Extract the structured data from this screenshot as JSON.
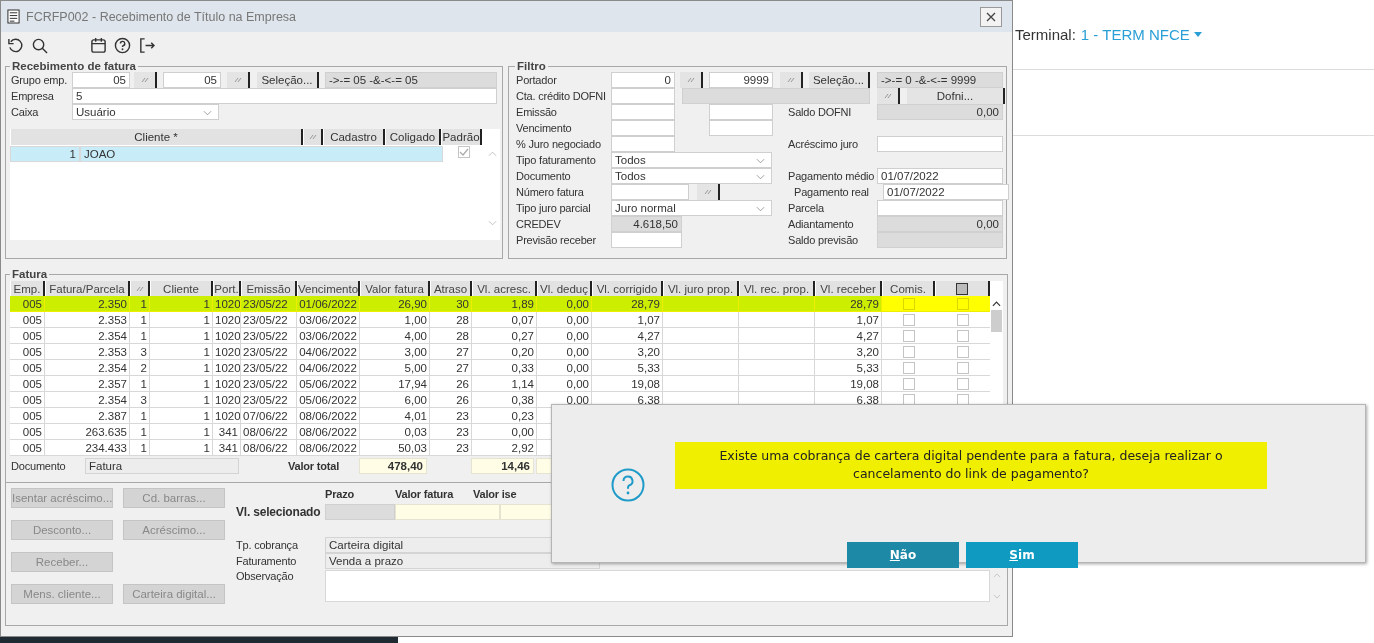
{
  "window": {
    "title": "FCRFP002 - Recebimento de Título na Empresa"
  },
  "recebimento": {
    "title": "Recebimento de fatura",
    "grupo_emp": {
      "label": "Grupo emp.",
      "from": "05",
      "to": "05",
      "selection_button": "Seleção...",
      "range": "->-= 05 -&-<-= 05"
    },
    "empresa": {
      "label": "Empresa",
      "value": "5"
    },
    "caixa": {
      "label": "Caixa",
      "value": "Usuário"
    },
    "clientes": {
      "columns": [
        "Cliente *",
        "Cadastro",
        "Coligado",
        "Padrão"
      ],
      "rows": [
        {
          "code": "1",
          "name": "JOAO",
          "padrao": true,
          "selected": true
        }
      ]
    }
  },
  "filtro": {
    "title": "Filtro",
    "portador": {
      "label": "Portador",
      "from": "0",
      "to": "9999",
      "selection_button": "Seleção...",
      "range": "->-= 0 -&-<-= 9999"
    },
    "cta_credito": {
      "label": "Cta. crédito DOFNI",
      "button": "Dofni..."
    },
    "emissao": {
      "label": "Emissão"
    },
    "vencimento": {
      "label": "Vencimento"
    },
    "juro_negociado": {
      "label": "% Juro negociado"
    },
    "tipo_faturamento": {
      "label": "Tipo faturamento",
      "value": "Todos"
    },
    "documento": {
      "label": "Documento",
      "value": "Todos"
    },
    "numero_fatura": {
      "label": "Número fatura"
    },
    "tipo_juro_parcial": {
      "label": "Tipo juro parcial",
      "value": "Juro normal"
    },
    "credev": {
      "label": "CREDEV",
      "value": "4.618,50"
    },
    "previsao_receber": {
      "label": "Previsão receber"
    },
    "saldo_dofni": {
      "label": "Saldo DOFNI",
      "value": "0,00"
    },
    "acrescimo_juro": {
      "label": "Acréscimo juro"
    },
    "pagamento_medio": {
      "label": "Pagamento médio",
      "value": "01/07/2022"
    },
    "pagamento_real": {
      "label": "Pagamento real",
      "value": "01/07/2022"
    },
    "parcela": {
      "label": "Parcela"
    },
    "adiantamento": {
      "label": "Adiantamento",
      "value": "0,00"
    },
    "saldo_previsao": {
      "label": "Saldo previsão"
    }
  },
  "fatura": {
    "title": "Fatura",
    "columns": [
      {
        "kind": "text",
        "label": "Emp."
      },
      {
        "kind": "text",
        "label": "Fatura/Parcela"
      },
      {
        "kind": "lookup"
      },
      {
        "kind": "text",
        "label": "Cliente"
      },
      {
        "kind": "text",
        "label": "Port."
      },
      {
        "kind": "text",
        "label": "Emissão"
      },
      {
        "kind": "text",
        "label": "Vencimento"
      },
      {
        "kind": "text",
        "label": "Valor fatura"
      },
      {
        "kind": "text",
        "label": "Atraso"
      },
      {
        "kind": "text",
        "label": "Vl. acresc."
      },
      {
        "kind": "text",
        "label": "Vl. deduç"
      },
      {
        "kind": "text",
        "label": "Vl. corrigido"
      },
      {
        "kind": "text",
        "label": "Vl. juro prop."
      },
      {
        "kind": "text",
        "label": "Vl. rec. prop."
      },
      {
        "kind": "text",
        "label": "Vl. receber"
      },
      {
        "kind": "text",
        "label": "Comis."
      },
      {
        "kind": "box"
      }
    ],
    "rows": [
      {
        "selected": true,
        "comis": false,
        "mark": false,
        "cells": [
          "005",
          "2.350",
          "1",
          "1",
          "1020",
          "23/05/22",
          "01/06/2022",
          "26,90",
          "30",
          "1,89",
          "0,00",
          "28,79",
          null,
          null,
          "28,79"
        ]
      },
      {
        "selected": false,
        "comis": false,
        "mark": false,
        "cells": [
          "005",
          "2.353",
          "1",
          "1",
          "1020",
          "23/05/22",
          "03/06/2022",
          "1,00",
          "28",
          "0,07",
          "0,00",
          "1,07",
          null,
          null,
          "1,07"
        ]
      },
      {
        "selected": false,
        "comis": false,
        "mark": false,
        "cells": [
          "005",
          "2.354",
          "1",
          "1",
          "1020",
          "23/05/22",
          "03/06/2022",
          "4,00",
          "28",
          "0,27",
          "0,00",
          "4,27",
          null,
          null,
          "4,27"
        ]
      },
      {
        "selected": false,
        "comis": false,
        "mark": false,
        "cells": [
          "005",
          "2.353",
          "3",
          "1",
          "1020",
          "23/05/22",
          "04/06/2022",
          "3,00",
          "27",
          "0,20",
          "0,00",
          "3,20",
          null,
          null,
          "3,20"
        ]
      },
      {
        "selected": false,
        "comis": false,
        "mark": false,
        "cells": [
          "005",
          "2.354",
          "2",
          "1",
          "1020",
          "23/05/22",
          "04/06/2022",
          "5,00",
          "27",
          "0,33",
          "0,00",
          "5,33",
          null,
          null,
          "5,33"
        ]
      },
      {
        "selected": false,
        "comis": false,
        "mark": false,
        "cells": [
          "005",
          "2.357",
          "1",
          "1",
          "1020",
          "23/05/22",
          "05/06/2022",
          "17,94",
          "26",
          "1,14",
          "0,00",
          "19,08",
          null,
          null,
          "19,08"
        ]
      },
      {
        "selected": false,
        "comis": false,
        "mark": false,
        "cells": [
          "005",
          "2.354",
          "3",
          "1",
          "1020",
          "23/05/22",
          "05/06/2022",
          "6,00",
          "26",
          "0,38",
          "0,00",
          "6,38",
          null,
          null,
          "6,38"
        ]
      },
      {
        "selected": false,
        "cells": [
          "005",
          "2.387",
          "1",
          "1",
          "1020",
          "07/06/22",
          "08/06/2022",
          "4,01",
          "23",
          "0,23"
        ]
      },
      {
        "selected": false,
        "cells": [
          "005",
          "263.635",
          "1",
          "1",
          "341",
          "08/06/22",
          "08/06/2022",
          "0,03",
          "23",
          "0,00"
        ]
      },
      {
        "selected": false,
        "cells": [
          "005",
          "234.433",
          "1",
          "1",
          "341",
          "08/06/22",
          "08/06/2022",
          "50,03",
          "23",
          "2,92"
        ]
      }
    ],
    "totals": {
      "documento_label": "Documento",
      "documento": "Fatura",
      "valor_total_label": "Valor total",
      "valor_fatura": "478,40",
      "vl_acresc": "14,46"
    }
  },
  "actions": [
    [
      {
        "label": "Isentar acréscimo...",
        "disabled": true
      },
      {
        "label": "Cd. barras...",
        "disabled": true
      }
    ],
    [
      {
        "label": "Desconto...",
        "disabled": true
      },
      {
        "label": "Acréscimo...",
        "disabled": true
      }
    ],
    [
      {
        "label": "Receber...",
        "disabled": true
      }
    ],
    [
      {
        "label": "Mens. cliente...",
        "disabled": true
      },
      {
        "label": "Carteira digital...",
        "disabled": true
      }
    ]
  ],
  "selecionado": {
    "label": "Vl. selecionado",
    "columns": [
      "Prazo",
      "Valor fatura",
      "Valor ise"
    ]
  },
  "tp_cobranca": {
    "label": "Tp. cobrança",
    "value": "Carteira digital"
  },
  "faturamento": {
    "label": "Faturamento",
    "value": "Venda a prazo"
  },
  "observacao": {
    "label": "Observação"
  },
  "dialog": {
    "message": "Existe uma cobrança de cartera digital pendente para a fatura, deseja realizar o cancelamento do link de pagamento?",
    "buttons": [
      {
        "label": "Não",
        "selected": true
      },
      {
        "label": "Sim",
        "selected": false
      }
    ]
  },
  "web_page": {
    "terminal_label": "Terminal:",
    "terminal_value": "1 - TERM NFCE"
  }
}
